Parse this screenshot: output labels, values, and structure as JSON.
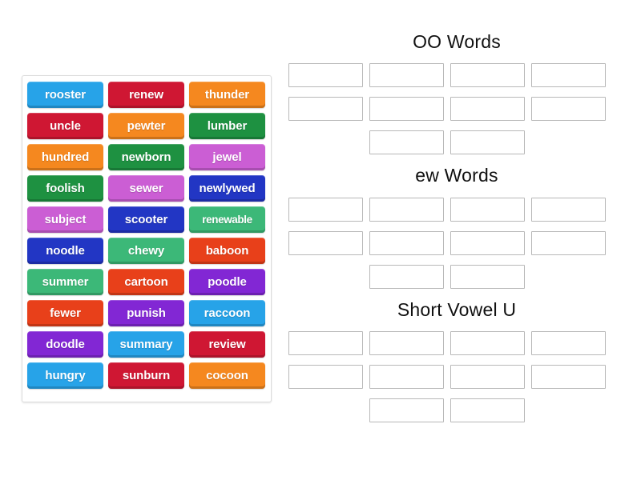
{
  "activity": {
    "type": "group-sort",
    "word_bank_label": "word bank"
  },
  "palette": {
    "blue": "#27a3e8",
    "red": "#cf1733",
    "orange": "#f5881f",
    "green": "#1e9141",
    "orchid": "#cb5ed4",
    "navy": "#2236c4",
    "emerald": "#3cb878",
    "vermillion": "#e8401a",
    "purple": "#8227d4",
    "slot_border": "#b8b8b8",
    "bank_border": "#dcdcdc",
    "title_text": "#111111",
    "tile_text": "#ffffff",
    "background": "#ffffff"
  },
  "word_bank": {
    "columns": 3,
    "rows": 10,
    "tiles": [
      {
        "label": "rooster",
        "color": "#27a3e8"
      },
      {
        "label": "renew",
        "color": "#cf1733"
      },
      {
        "label": "thunder",
        "color": "#f5881f"
      },
      {
        "label": "uncle",
        "color": "#cf1733"
      },
      {
        "label": "pewter",
        "color": "#f5881f"
      },
      {
        "label": "lumber",
        "color": "#1e9141"
      },
      {
        "label": "hundred",
        "color": "#f5881f"
      },
      {
        "label": "newborn",
        "color": "#1e9141"
      },
      {
        "label": "jewel",
        "color": "#cb5ed4"
      },
      {
        "label": "foolish",
        "color": "#1e9141"
      },
      {
        "label": "sewer",
        "color": "#cb5ed4"
      },
      {
        "label": "newlywed",
        "color": "#2236c4"
      },
      {
        "label": "subject",
        "color": "#cb5ed4"
      },
      {
        "label": "scooter",
        "color": "#2236c4"
      },
      {
        "label": "renewable",
        "color": "#3cb878"
      },
      {
        "label": "noodle",
        "color": "#2236c4"
      },
      {
        "label": "chewy",
        "color": "#3cb878"
      },
      {
        "label": "baboon",
        "color": "#e8401a"
      },
      {
        "label": "summer",
        "color": "#3cb878"
      },
      {
        "label": "cartoon",
        "color": "#e8401a"
      },
      {
        "label": "poodle",
        "color": "#8227d4"
      },
      {
        "label": "fewer",
        "color": "#e8401a"
      },
      {
        "label": "punish",
        "color": "#8227d4"
      },
      {
        "label": "raccoon",
        "color": "#27a3e8"
      },
      {
        "label": "doodle",
        "color": "#8227d4"
      },
      {
        "label": "summary",
        "color": "#27a3e8"
      },
      {
        "label": "review",
        "color": "#cf1733"
      },
      {
        "label": "hungry",
        "color": "#27a3e8"
      },
      {
        "label": "sunburn",
        "color": "#cf1733"
      },
      {
        "label": "cocoon",
        "color": "#f5881f"
      }
    ]
  },
  "categories": [
    {
      "title": "OO Words",
      "slot_rows": [
        {
          "count": 4,
          "offset": false
        },
        {
          "count": 4,
          "offset": false
        },
        {
          "count": 2,
          "offset": true
        }
      ],
      "slot_total": 10
    },
    {
      "title": "ew Words",
      "slot_rows": [
        {
          "count": 4,
          "offset": false
        },
        {
          "count": 4,
          "offset": false
        },
        {
          "count": 2,
          "offset": true
        }
      ],
      "slot_total": 10
    },
    {
      "title": "Short Vowel U",
      "slot_rows": [
        {
          "count": 4,
          "offset": false
        },
        {
          "count": 4,
          "offset": false
        },
        {
          "count": 2,
          "offset": true
        }
      ],
      "slot_total": 10
    }
  ]
}
